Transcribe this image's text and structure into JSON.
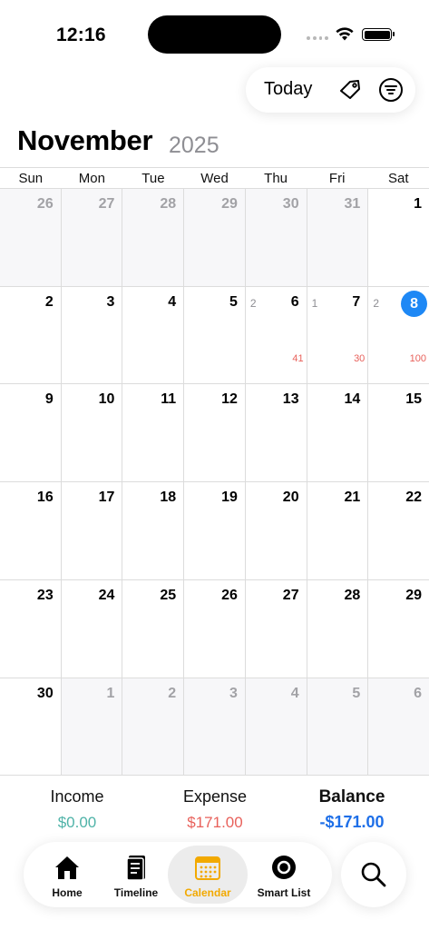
{
  "status_bar": {
    "time": "12:16"
  },
  "toolbar": {
    "today_label": "Today"
  },
  "header": {
    "month": "November",
    "year": "2025"
  },
  "weekdays": [
    "Sun",
    "Mon",
    "Tue",
    "Wed",
    "Thu",
    "Fri",
    "Sat"
  ],
  "calendar": {
    "weeks": [
      [
        {
          "day": "26",
          "other": true
        },
        {
          "day": "27",
          "other": true
        },
        {
          "day": "28",
          "other": true
        },
        {
          "day": "29",
          "other": true
        },
        {
          "day": "30",
          "other": true
        },
        {
          "day": "31",
          "other": true
        },
        {
          "day": "1"
        }
      ],
      [
        {
          "day": "2"
        },
        {
          "day": "3"
        },
        {
          "day": "4"
        },
        {
          "day": "5"
        },
        {
          "day": "6",
          "count": "2",
          "expense": "41"
        },
        {
          "day": "7",
          "count": "1",
          "expense": "30"
        },
        {
          "day": "8",
          "count": "2",
          "expense": "100",
          "today": true
        }
      ],
      [
        {
          "day": "9"
        },
        {
          "day": "10"
        },
        {
          "day": "11"
        },
        {
          "day": "12"
        },
        {
          "day": "13"
        },
        {
          "day": "14"
        },
        {
          "day": "15"
        }
      ],
      [
        {
          "day": "16"
        },
        {
          "day": "17"
        },
        {
          "day": "18"
        },
        {
          "day": "19"
        },
        {
          "day": "20"
        },
        {
          "day": "21"
        },
        {
          "day": "22"
        }
      ],
      [
        {
          "day": "23"
        },
        {
          "day": "24"
        },
        {
          "day": "25"
        },
        {
          "day": "26"
        },
        {
          "day": "27"
        },
        {
          "day": "28"
        },
        {
          "day": "29"
        }
      ],
      [
        {
          "day": "30"
        },
        {
          "day": "1",
          "other": true
        },
        {
          "day": "2",
          "other": true
        },
        {
          "day": "3",
          "other": true
        },
        {
          "day": "4",
          "other": true
        },
        {
          "day": "5",
          "other": true
        },
        {
          "day": "6",
          "other": true
        }
      ]
    ]
  },
  "summary": {
    "income_label": "Income",
    "income_value": "$0.00",
    "expense_label": "Expense",
    "expense_value": "$171.00",
    "balance_label": "Balance",
    "balance_value": "-$171.00"
  },
  "tabs": [
    {
      "label": "Home",
      "icon": "home-icon"
    },
    {
      "label": "Timeline",
      "icon": "timeline-icon"
    },
    {
      "label": "Calendar",
      "icon": "calendar-icon",
      "active": true
    },
    {
      "label": "Smart List",
      "icon": "smart-list-icon"
    }
  ],
  "colors": {
    "accent_blue": "#1e88f5",
    "expense_red": "#e8615b",
    "income_teal": "#4fb3a8",
    "balance_blue": "#1e6fe8",
    "active_tab": "#f2a900"
  }
}
